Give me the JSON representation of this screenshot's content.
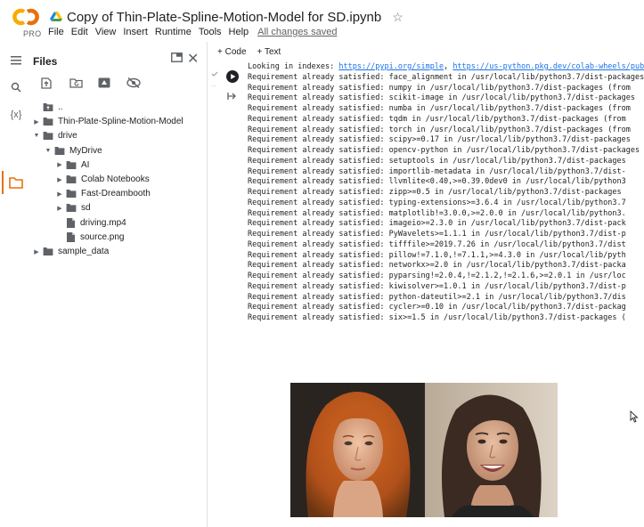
{
  "header": {
    "logo_label": "PRO",
    "notebook_title": "Copy of Thin-Plate-Spline-Motion-Model for SD.ipynb",
    "star_glyph": "☆",
    "menu": [
      "File",
      "Edit",
      "View",
      "Insert",
      "Runtime",
      "Tools",
      "Help"
    ],
    "saved_status": "All changes saved"
  },
  "rail": {
    "items": [
      {
        "name": "toc-icon",
        "glyph": "☰"
      },
      {
        "name": "search-icon",
        "glyph": "🔍"
      },
      {
        "name": "variables-icon",
        "glyph": "{x}"
      },
      {
        "name": "files-icon",
        "glyph": ""
      }
    ]
  },
  "files": {
    "title": "Files",
    "close_glyph": "✕",
    "tree": [
      {
        "label": "..",
        "kind": "folder-up",
        "depth": 0,
        "arrow": ""
      },
      {
        "label": "Thin-Plate-Spline-Motion-Model",
        "kind": "folder",
        "depth": 0,
        "arrow": "▶"
      },
      {
        "label": "drive",
        "kind": "folder",
        "depth": 0,
        "arrow": "▼"
      },
      {
        "label": "MyDrive",
        "kind": "folder",
        "depth": 1,
        "arrow": "▼"
      },
      {
        "label": "AI",
        "kind": "folder",
        "depth": 2,
        "arrow": "▶"
      },
      {
        "label": "Colab Notebooks",
        "kind": "folder",
        "depth": 2,
        "arrow": "▶"
      },
      {
        "label": "Fast-Dreambooth",
        "kind": "folder",
        "depth": 2,
        "arrow": "▶"
      },
      {
        "label": "sd",
        "kind": "folder",
        "depth": 2,
        "arrow": "▶"
      },
      {
        "label": "driving.mp4",
        "kind": "file",
        "depth": 2,
        "arrow": ""
      },
      {
        "label": "source.png",
        "kind": "file",
        "depth": 2,
        "arrow": ""
      },
      {
        "label": "sample_data",
        "kind": "folder",
        "depth": 0,
        "arrow": "▶"
      }
    ]
  },
  "notebook": {
    "add_code": "+ Code",
    "add_text": "+ Text",
    "output_first_prefix": "Looking in indexes: ",
    "output_first_link1": "https://pypi.org/simple",
    "output_first_sep": ", ",
    "output_first_link2": "https://us-python.pkg.dev/colab-wheels/public/simple/",
    "output_lines": [
      "Requirement already satisfied: face_alignment in /usr/local/lib/python3.7/dist-packages",
      "Requirement already satisfied: numpy in /usr/local/lib/python3.7/dist-packages (from",
      "Requirement already satisfied: scikit-image in /usr/local/lib/python3.7/dist-packages",
      "Requirement already satisfied: numba in /usr/local/lib/python3.7/dist-packages (from",
      "Requirement already satisfied: tqdm in /usr/local/lib/python3.7/dist-packages (from",
      "Requirement already satisfied: torch in /usr/local/lib/python3.7/dist-packages (from",
      "Requirement already satisfied: scipy>=0.17 in /usr/local/lib/python3.7/dist-packages",
      "Requirement already satisfied: opencv-python in /usr/local/lib/python3.7/dist-packages",
      "Requirement already satisfied: setuptools in /usr/local/lib/python3.7/dist-packages",
      "Requirement already satisfied: importlib-metadata in /usr/local/lib/python3.7/dist-",
      "Requirement already satisfied: llvmlite<0.40,>=0.39.0dev0 in /usr/local/lib/python3",
      "Requirement already satisfied: zipp>=0.5 in /usr/local/lib/python3.7/dist-packages",
      "Requirement already satisfied: typing-extensions>=3.6.4 in /usr/local/lib/python3.7",
      "Requirement already satisfied: matplotlib!=3.0.0,>=2.0.0 in /usr/local/lib/python3.",
      "Requirement already satisfied: imageio>=2.3.0 in /usr/local/lib/python3.7/dist-pack",
      "Requirement already satisfied: PyWavelets>=1.1.1 in /usr/local/lib/python3.7/dist-p",
      "Requirement already satisfied: tifffile>=2019.7.26 in /usr/local/lib/python3.7/dist",
      "Requirement already satisfied: pillow!=7.1.0,!=7.1.1,>=4.3.0 in /usr/local/lib/pyth",
      "Requirement already satisfied: networkx>=2.0 in /usr/local/lib/python3.7/dist-packa",
      "Requirement already satisfied: pyparsing!=2.0.4,!=2.1.2,!=2.1.6,>=2.0.1 in /usr/loc",
      "Requirement already satisfied: kiwisolver>=1.0.1 in /usr/local/lib/python3.7/dist-p",
      "Requirement already satisfied: python-dateutil>=2.1 in /usr/local/lib/python3.7/dis",
      "Requirement already satisfied: cycler>=0.10 in /usr/local/lib/python3.7/dist-packag",
      "Requirement already satisfied: six>=1.5 in /usr/local/lib/python3.7/dist-packages ("
    ]
  },
  "colors": {
    "accent_orange": "#F9AB00",
    "accent_orange_dark": "#E8710A",
    "link_blue": "#1a73e8",
    "active_rail": "#E8710A"
  }
}
